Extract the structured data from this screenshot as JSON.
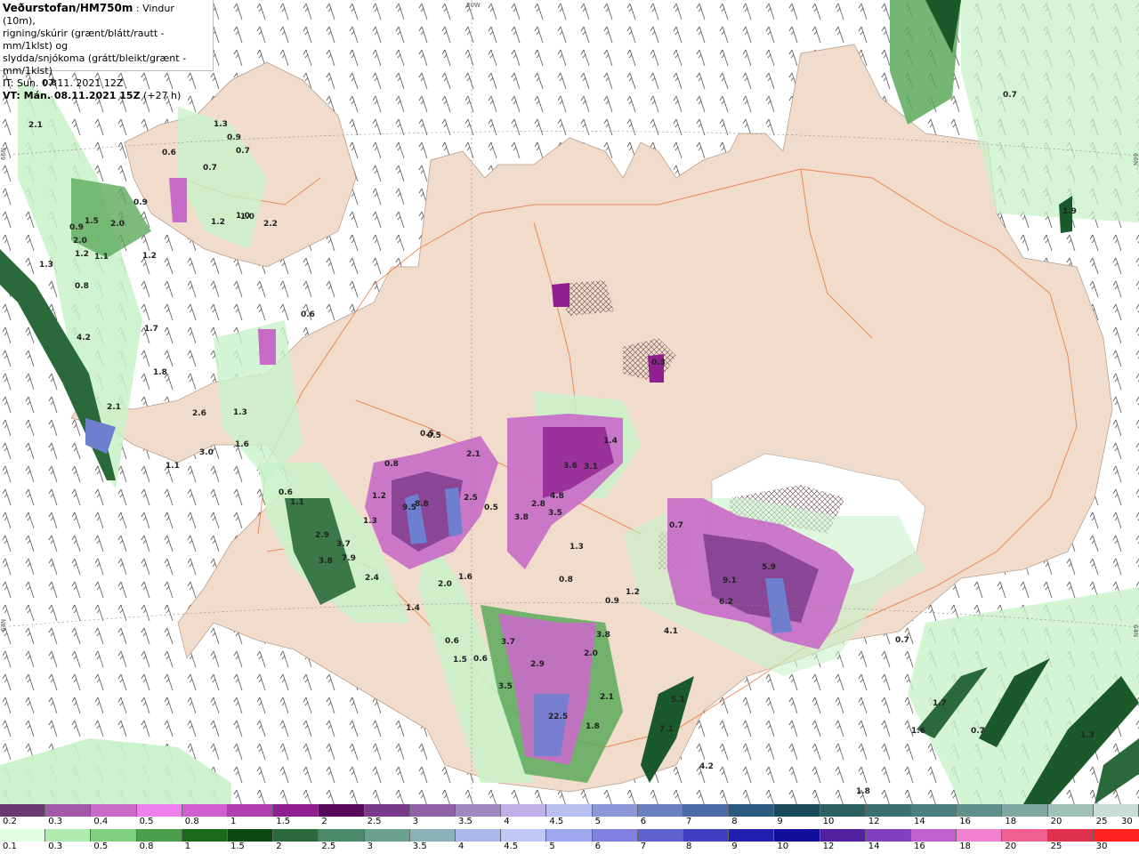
{
  "header": {
    "title": "Veðurstofan/HM750m",
    "line1_suffix": " : Vindur (10m),",
    "line2": "rigning/skúrir (grænt/blátt/rautt - mm/1klst) og",
    "line3": "slydda/snjókoma (grátt/bleikt/grænt - mm/1klst)",
    "issue_time": "IT: Sun. 07.11. 2021 12Z",
    "valid_time": "VT: Mán. 08.11.2021 15Z",
    "lead_time": " (+27 h)"
  },
  "graticule": {
    "lon_label": "20W",
    "lat_label_66_left": "66N",
    "lat_label_66_right": "66N",
    "lat_label_64_left": "64N",
    "lat_label_64_right": "64N"
  },
  "colors": {
    "land": "#f1dccb",
    "sea": "#ffffff",
    "roads": "#e8743a",
    "rain_light": "#c8f2c8",
    "rain_mid": "#5caa5c",
    "rain_dark": "#1a5a2a",
    "snow_purple": "#b23fc6",
    "snow_blue": "#6f7fd0"
  },
  "legend_snow": {
    "labels": [
      "0.2",
      "0.3",
      "0.4",
      "0.5",
      "0.8",
      "1",
      "1.5",
      "2",
      "2.5",
      "3",
      "3.5",
      "4",
      "4.5",
      "5",
      "6",
      "7",
      "8",
      "9",
      "10",
      "12",
      "14",
      "16",
      "18",
      "20",
      "25",
      "30"
    ],
    "colors": [
      "#6a3a70",
      "#a05aa8",
      "#c86ac8",
      "#ee80ee",
      "#d060d0",
      "#b040b0",
      "#902090",
      "#5a0a5a",
      "#7a3a8a",
      "#9060a8",
      "#a088c0",
      "#c0b0e8",
      "#b8c0f0",
      "#8a98d8",
      "#6a80c0",
      "#4a6aa8",
      "#2a5a80",
      "#1a4a5a",
      "#2a6060",
      "#3a7070",
      "#4a8080",
      "#60908a",
      "#80a8a0",
      "#a0c0b8",
      "#c8dcd8"
    ]
  },
  "legend_rain": {
    "labels": [
      "0.1",
      "0.3",
      "0.5",
      "0.8",
      "1",
      "1.5",
      "2",
      "2.5",
      "3",
      "3.5",
      "4",
      "4.5",
      "5",
      "6",
      "7",
      "8",
      "9",
      "10",
      "12",
      "14",
      "16",
      "18",
      "20",
      "25",
      "30"
    ],
    "colors": [
      "#e0ffe0",
      "#b0ecb0",
      "#80d080",
      "#4aa04a",
      "#1a6a1a",
      "#0a4a10",
      "#2a6a3a",
      "#4a8a6a",
      "#6aa090",
      "#8ab0b8",
      "#a8b8e8",
      "#c0c8f8",
      "#a0a8f0",
      "#8080e0",
      "#6060d0",
      "#4040c0",
      "#2020b0",
      "#10109a",
      "#5020a0",
      "#8040c0",
      "#c060d0",
      "#f080d0",
      "#f06090",
      "#e03050",
      "#ff2020"
    ]
  },
  "values": [
    "0.8",
    "2.1",
    "0.6",
    "1.3",
    "0.9",
    "0.7",
    "0.5",
    "0.9",
    "0.7",
    "1.0",
    "1.2",
    "2.2",
    "0.9",
    "1.2",
    "2.0",
    "1.5",
    "2.0",
    "1.1",
    "1.2",
    "0.8",
    "1.3",
    "0.6",
    "4.2",
    "1.7",
    "1.8",
    "2.1",
    "1.0",
    "2.6",
    "1.3",
    "1.6",
    "3.0",
    "1.1",
    "0.5",
    "0.8",
    "1.2",
    "0.6",
    "1.1",
    "3.7",
    "7.9",
    "3.8",
    "2.9",
    "1.3",
    "2.4",
    "9.5",
    "8.8",
    "2.1",
    "2.5",
    "3.8",
    "2.8",
    "3.5",
    "3.6",
    "3.1",
    "1.4",
    "4.8",
    "1.3",
    "0.5",
    "0.8",
    "1.2",
    "0.9",
    "1.4",
    "2.0",
    "1.6",
    "0.6",
    "1.5",
    "3.7",
    "2.9",
    "3.8",
    "2.0",
    "3.5",
    "22.5",
    "1.8",
    "0.6",
    "0.7",
    "4.1",
    "5.1",
    "7.1",
    "4.2",
    "1.3",
    "0.7",
    "1.6",
    "1.7",
    "0.7",
    "1.8",
    "1.9",
    "2.1",
    "5.9",
    "6.2",
    "9.1",
    "0.3",
    "0.7"
  ]
}
